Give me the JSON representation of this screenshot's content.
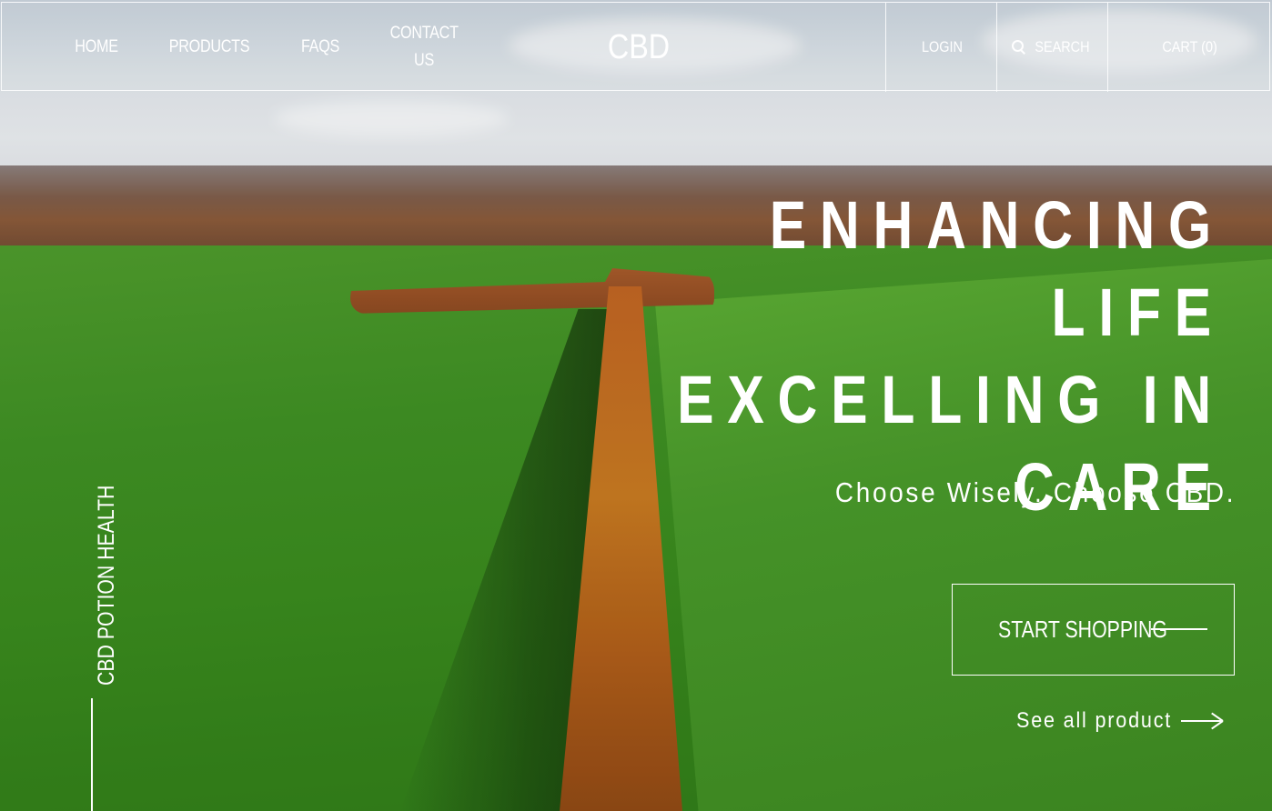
{
  "header": {
    "nav": [
      {
        "label": "HOME"
      },
      {
        "label": "PRODUCTS"
      },
      {
        "label": "FAQS"
      },
      {
        "label": "CONTACT US"
      }
    ],
    "logo": "CBD",
    "login_label": "LOGIN",
    "search_label": "SEARCH",
    "cart_label": "CART (0)"
  },
  "hero": {
    "headline": [
      "ENHANCING LIFE",
      "EXCELLING IN",
      "CARE"
    ],
    "tagline": "Choose Wisely. Choose CBD.",
    "cta_label": "START SHOPPING",
    "see_all_label": "See all product",
    "side_label": "CBD POTION HEALTH"
  },
  "icons": {
    "search": "search-icon",
    "arrow": "arrow-right-icon"
  },
  "colors": {
    "text": "#ffffff",
    "border": "#ffffff"
  }
}
